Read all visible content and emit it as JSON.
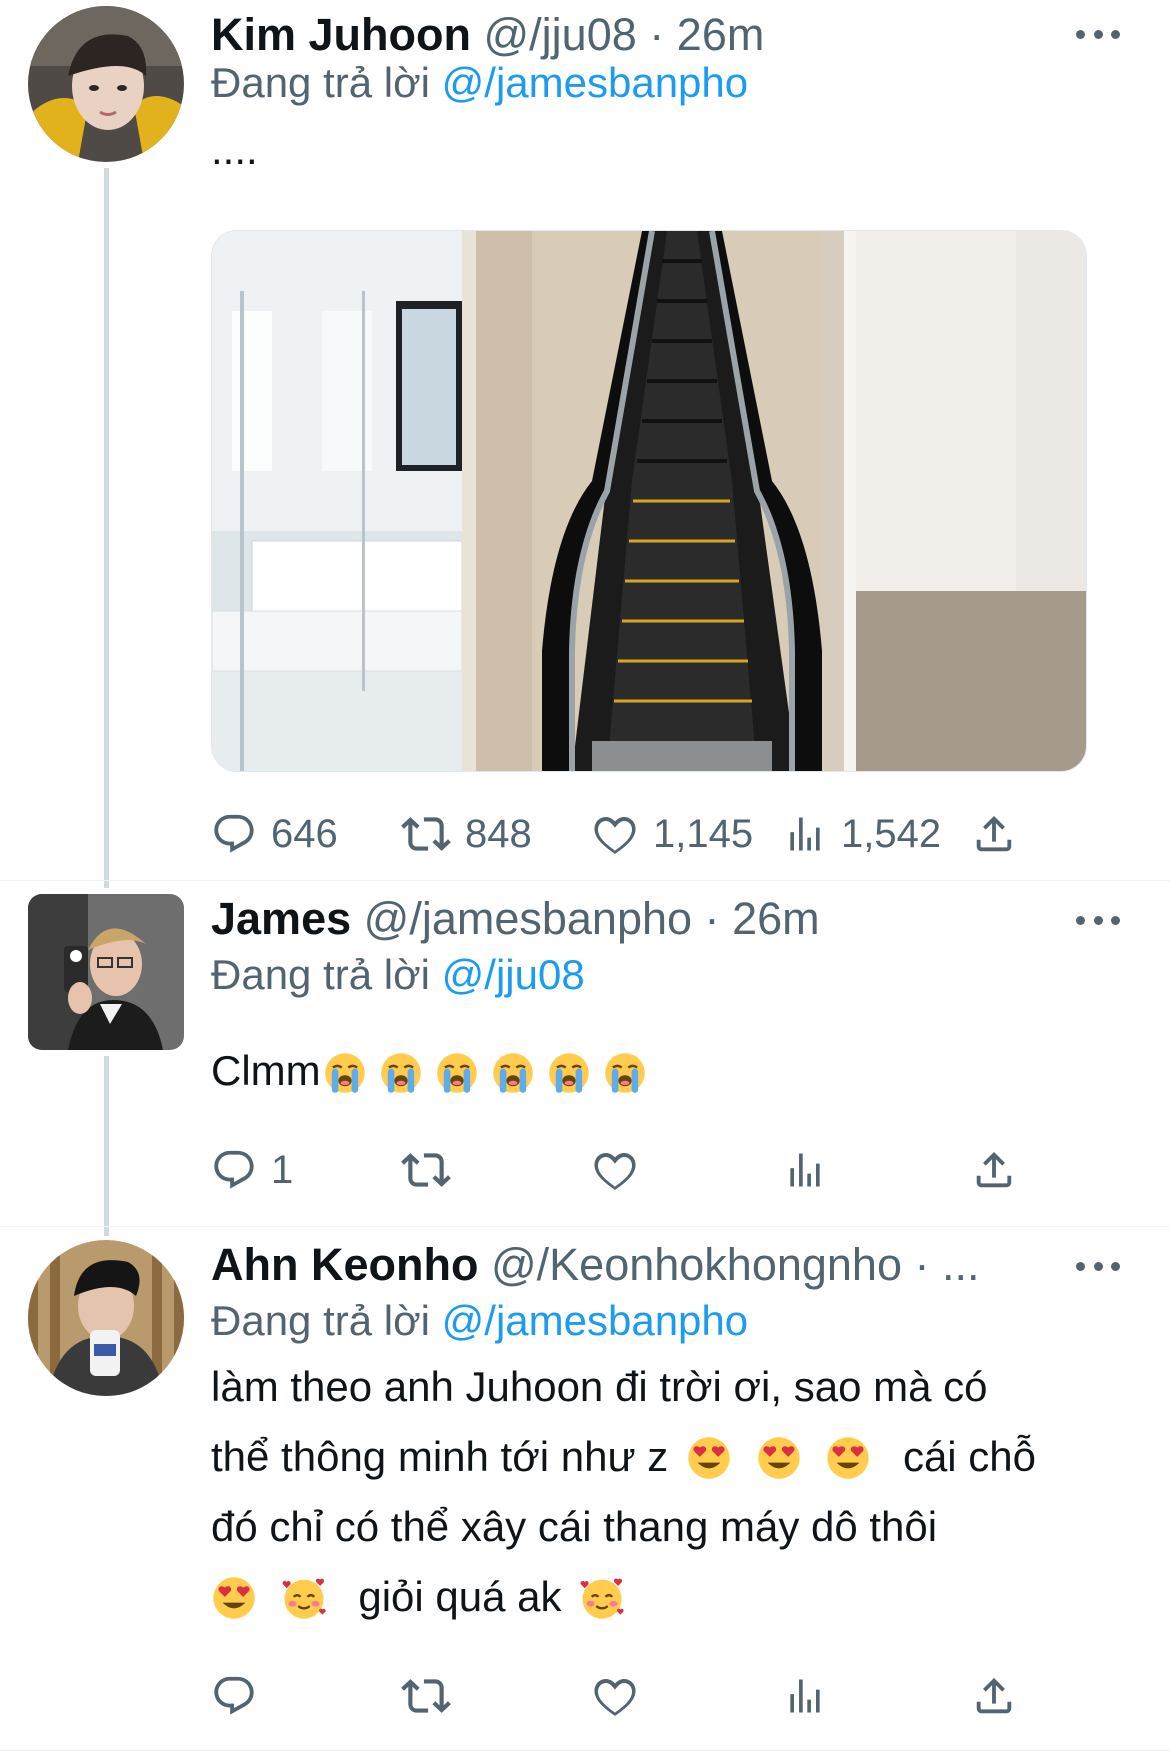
{
  "tweets": [
    {
      "name": "Kim Juhoon",
      "handle": "@/jju08",
      "time": "26m",
      "separator": "·",
      "replying_label": "Đang trả lời",
      "replying_to": "@/jamesbanpho",
      "text": "....",
      "media_description": "Bathroom next to an indoor escalator",
      "actions": {
        "replies": "646",
        "retweets": "848",
        "likes": "1,145",
        "views": "1,542"
      }
    },
    {
      "name": "James",
      "handle": "@/jamesbanpho",
      "time": "26m",
      "separator": "·",
      "replying_label": "Đang trả lời",
      "replying_to": "@/jju08",
      "text": "Clmm",
      "emoji_count": 6,
      "emoji_name": "loudly-crying-face",
      "actions": {
        "replies": "1",
        "retweets": "",
        "likes": "",
        "views": ""
      }
    },
    {
      "name": "Ahn Keonho",
      "handle": "@/Keonhokhongnho",
      "time": "...",
      "separator": "·",
      "replying_label": "Đang trả lời",
      "replying_to": "@/jamesbanpho",
      "text_line1": "làm theo anh Juhoon đi trời ơi, sao mà có",
      "text_line2": "thể thông minh tới như z",
      "text_line2b": "cái chỗ",
      "text_line3": "đó chỉ có thể xây cái thang máy dô thôi",
      "text_line4": "giỏi quá ak",
      "actions": {
        "replies": "",
        "retweets": "",
        "likes": "",
        "views": ""
      }
    }
  ],
  "colors": {
    "text": "#0f1419",
    "secondary": "#536471",
    "link": "#1d9bf0",
    "thread": "#cfd9de"
  },
  "icons": [
    "reply-icon",
    "retweet-icon",
    "like-icon",
    "views-icon",
    "share-icon",
    "more-icon"
  ]
}
